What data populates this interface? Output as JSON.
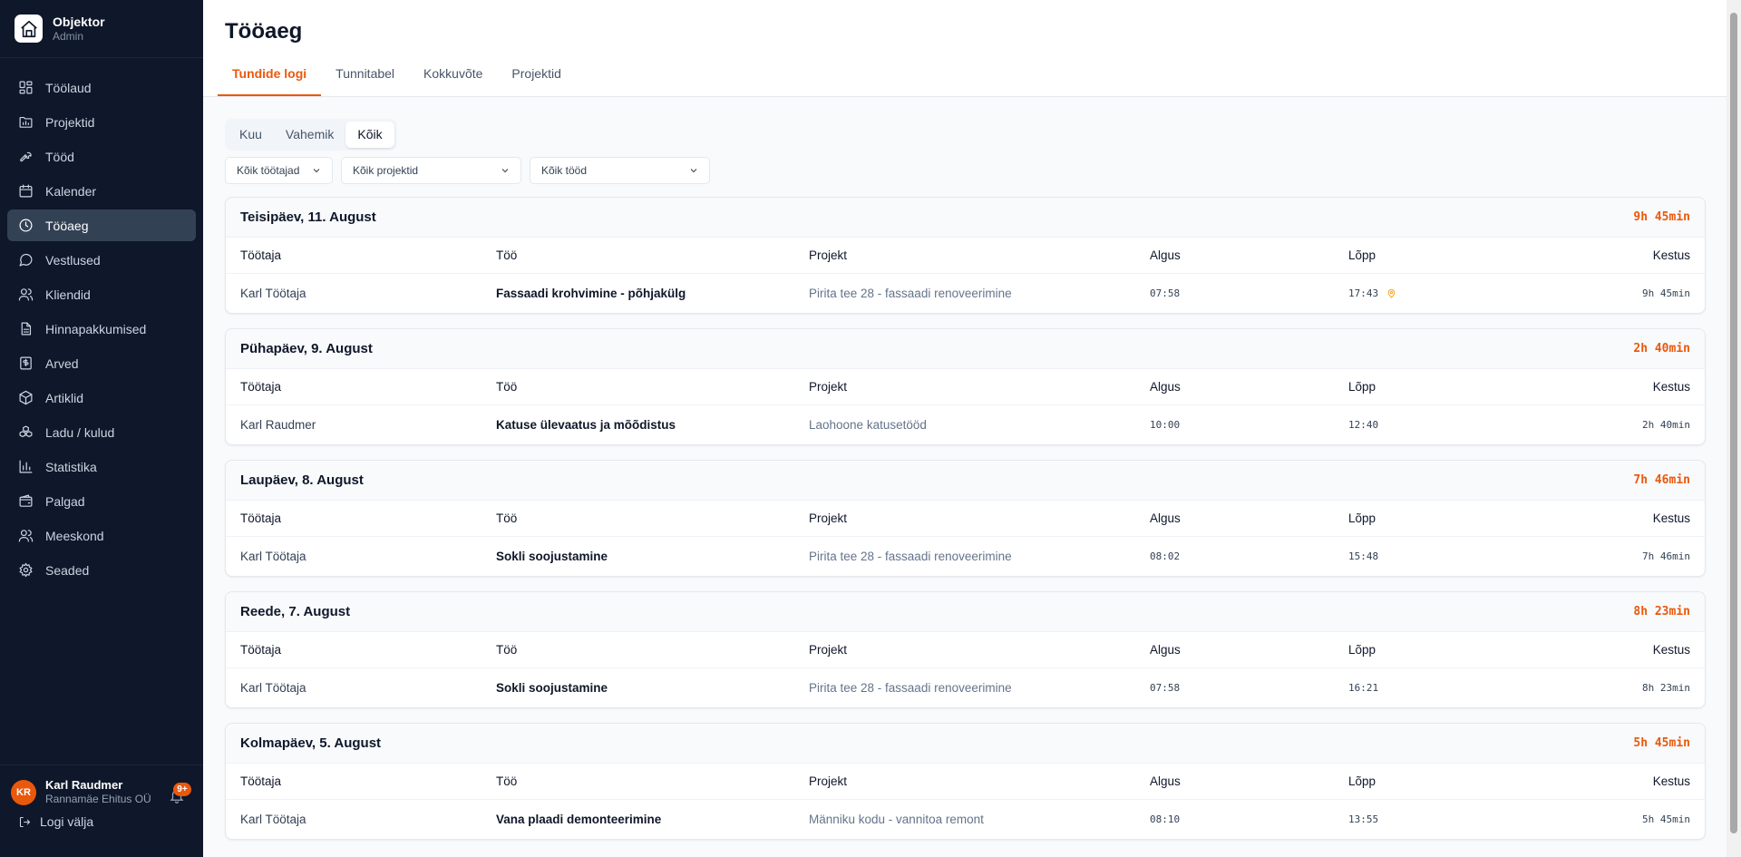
{
  "brand": {
    "name": "Objektor",
    "role": "Admin"
  },
  "nav": [
    {
      "label": "Töölaud",
      "icon": "dashboard-icon",
      "active": false
    },
    {
      "label": "Projektid",
      "icon": "folder-icon",
      "active": false
    },
    {
      "label": "Tööd",
      "icon": "wrench-icon",
      "active": false
    },
    {
      "label": "Kalender",
      "icon": "calendar-icon",
      "active": false
    },
    {
      "label": "Tööaeg",
      "icon": "clock-icon",
      "active": true
    },
    {
      "label": "Vestlused",
      "icon": "chat-icon",
      "active": false
    },
    {
      "label": "Kliendid",
      "icon": "users-icon",
      "active": false
    },
    {
      "label": "Hinnapakkumised",
      "icon": "document-icon",
      "active": false
    },
    {
      "label": "Arved",
      "icon": "invoice-icon",
      "active": false
    },
    {
      "label": "Artiklid",
      "icon": "box-icon",
      "active": false
    },
    {
      "label": "Ladu / kulud",
      "icon": "boxes-icon",
      "active": false
    },
    {
      "label": "Statistika",
      "icon": "bar-chart-icon",
      "active": false
    },
    {
      "label": "Palgad",
      "icon": "wallet-icon",
      "active": false
    },
    {
      "label": "Meeskond",
      "icon": "team-icon",
      "active": false
    },
    {
      "label": "Seaded",
      "icon": "gear-icon",
      "active": false
    }
  ],
  "user": {
    "initials": "KR",
    "name": "Karl Raudmer",
    "company": "Rannamäe Ehitus OÜ",
    "notifications": "9+"
  },
  "logout_label": "Logi välja",
  "page": {
    "title": "Tööaeg",
    "tabs": [
      {
        "label": "Tundide logi",
        "active": true
      },
      {
        "label": "Tunnitabel",
        "active": false
      },
      {
        "label": "Kokkuvõte",
        "active": false
      },
      {
        "label": "Projektid",
        "active": false
      }
    ],
    "period": [
      {
        "label": "Kuu",
        "active": false
      },
      {
        "label": "Vahemik",
        "active": false
      },
      {
        "label": "Kõik",
        "active": true
      }
    ],
    "filters": {
      "workers": "Kõik töötajad",
      "projects": "Kõik projektid",
      "jobs": "Kõik tööd"
    },
    "columns": {
      "employee": "Töötaja",
      "job": "Töö",
      "project": "Projekt",
      "start": "Algus",
      "end": "Lõpp",
      "duration": "Kestus"
    },
    "days": [
      {
        "title": "Teisipäev, 11. August",
        "total": "9h 45min",
        "entries": [
          {
            "employee": "Karl Töötaja",
            "job": "Fassaadi krohvimine - põhjakülg",
            "project": "Pirita tee 28 - fassaadi renoveerimine",
            "start": "07:58",
            "end": "17:43",
            "location": true,
            "duration": "9h 45min"
          }
        ]
      },
      {
        "title": "Pühapäev, 9. August",
        "total": "2h 40min",
        "entries": [
          {
            "employee": "Karl Raudmer",
            "job": "Katuse ülevaatus ja mõõdistus",
            "project": "Laohoone katusetööd",
            "start": "10:00",
            "end": "12:40",
            "location": false,
            "duration": "2h 40min"
          }
        ]
      },
      {
        "title": "Laupäev, 8. August",
        "total": "7h 46min",
        "entries": [
          {
            "employee": "Karl Töötaja",
            "job": "Sokli soojustamine",
            "project": "Pirita tee 28 - fassaadi renoveerimine",
            "start": "08:02",
            "end": "15:48",
            "location": false,
            "duration": "7h 46min"
          }
        ]
      },
      {
        "title": "Reede, 7. August",
        "total": "8h 23min",
        "entries": [
          {
            "employee": "Karl Töötaja",
            "job": "Sokli soojustamine",
            "project": "Pirita tee 28 - fassaadi renoveerimine",
            "start": "07:58",
            "end": "16:21",
            "location": false,
            "duration": "8h 23min"
          }
        ]
      },
      {
        "title": "Kolmapäev, 5. August",
        "total": "5h 45min",
        "entries": [
          {
            "employee": "Karl Töötaja",
            "job": "Vana plaadi demonteerimine",
            "project": "Männiku kodu - vannitoa remont",
            "start": "08:10",
            "end": "13:55",
            "location": false,
            "duration": "5h 45min"
          }
        ]
      }
    ]
  },
  "colors": {
    "accent": "#ea580c",
    "sidebar": "#0f172a",
    "active_nav": "#334155",
    "location_pin": "#f59e0b"
  }
}
